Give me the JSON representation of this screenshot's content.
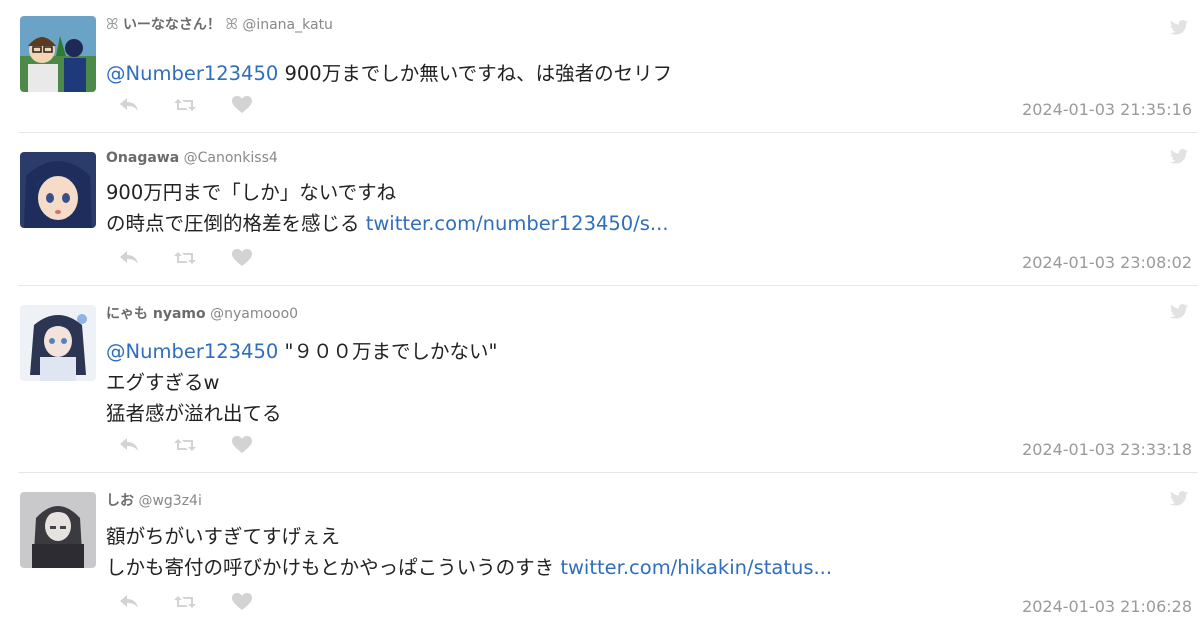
{
  "colors": {
    "link": "#2f6ebd",
    "meta": "#888888",
    "icon": "#d3d3d3",
    "separator": "#e6e6e6"
  },
  "tweets": [
    {
      "display_name": "いーななさん！",
      "handle": "@inana_katu",
      "mention": "@Number123450",
      "lines": [
        " 900万までしか無いですね、は強者のセリフ"
      ],
      "link": "",
      "timestamp": "2024-01-03 21:35:16"
    },
    {
      "display_name": "Onagawa",
      "handle": "@Canonkiss4",
      "lines": [
        "900万円まで「しか」ないですね",
        "の時点で圧倒的格差を感じる "
      ],
      "link": "twitter.com/number123450/s...",
      "timestamp": "2024-01-03 23:08:02"
    },
    {
      "display_name": "にゃも nyamo",
      "handle": "@nyamooo0",
      "mention": "@Number123450",
      "lines": [
        " \"９００万までしかない\"",
        "エグすぎるw",
        "猛者感が溢れ出てる"
      ],
      "link": "",
      "timestamp": "2024-01-03 23:33:18"
    },
    {
      "display_name": "しお",
      "handle": "@wg3z4i",
      "lines": [
        "額がちがいすぎてすげぇえ",
        "しかも寄付の呼びかけもとかやっぱこういうのすき "
      ],
      "link": "twitter.com/hikakin/status...",
      "timestamp": "2024-01-03 21:06:28"
    }
  ],
  "icons": {
    "reply": "reply-icon",
    "retweet": "retweet-icon",
    "like": "heart-icon",
    "brand": "twitter-bird-icon"
  }
}
